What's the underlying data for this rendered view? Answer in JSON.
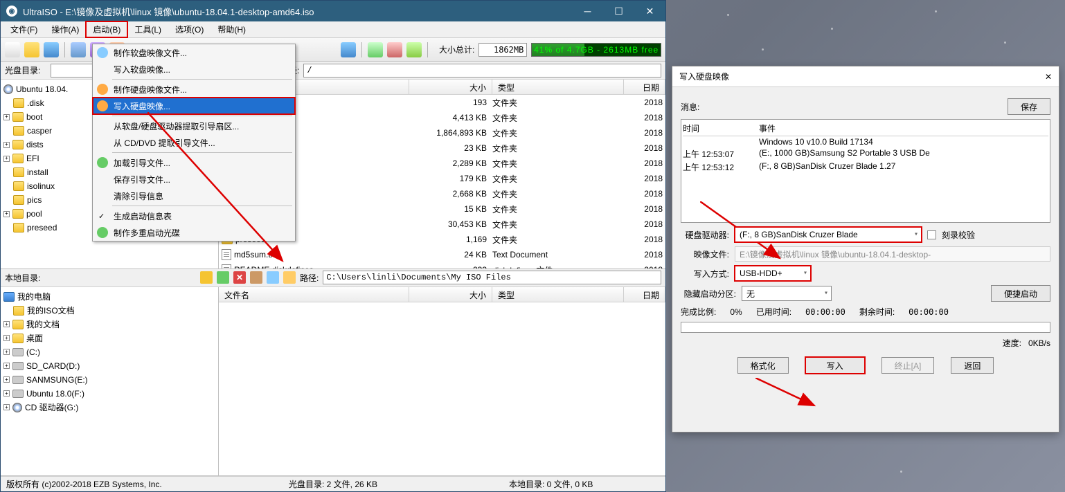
{
  "window": {
    "title": "UltraISO - E:\\镜像及虚拟机\\linux 镜像\\ubuntu-18.04.1-desktop-amd64.iso"
  },
  "menus": {
    "file": "文件(F)",
    "operate": "操作(A)",
    "boot": "启动(B)",
    "tools": "工具(L)",
    "options": "选项(O)",
    "help": "帮助(H)"
  },
  "toolbar": {
    "size_label": "大小总计:",
    "size_value": "1862MB",
    "usage_text": "41% of 4.7GB - 2613MB free"
  },
  "disc_panel": {
    "label": "光盘目录:",
    "path_label": "路径:",
    "path_value": "/"
  },
  "dropdown": {
    "make_floppy": "制作软盘映像文件...",
    "write_floppy": "写入软盘映像...",
    "make_hdd": "制作硬盘映像文件...",
    "write_hdd": "写入硬盘映像...",
    "from_floppy_hdd": "从软盘/硬盘驱动器提取引导扇区...",
    "from_cddvd": "从 CD/DVD 提取引导文件...",
    "load_boot": "加载引导文件...",
    "save_boot": "保存引导文件...",
    "clear_boot": "清除引导信息",
    "gen_boot_table": "生成启动信息表",
    "make_multi": "制作多重启动光碟"
  },
  "tree_top": {
    "root": "Ubuntu 18.04.",
    "items": [
      ".disk",
      "boot",
      "casper",
      "dists",
      "EFI",
      "install",
      "isolinux",
      "pics",
      "pool",
      "preseed"
    ]
  },
  "file_cols": {
    "name": "文件名",
    "size": "大小",
    "type": "类型",
    "date": "日期"
  },
  "files_top": [
    {
      "name": "",
      "size": "193",
      "type": "文件夹",
      "date": "2018"
    },
    {
      "name": "",
      "size": "4,413 KB",
      "type": "文件夹",
      "date": "2018"
    },
    {
      "name": "",
      "size": "1,864,893 KB",
      "type": "文件夹",
      "date": "2018"
    },
    {
      "name": "",
      "size": "23 KB",
      "type": "文件夹",
      "date": "2018"
    },
    {
      "name": "",
      "size": "2,289 KB",
      "type": "文件夹",
      "date": "2018"
    },
    {
      "name": "",
      "size": "179 KB",
      "type": "文件夹",
      "date": "2018"
    },
    {
      "name": "",
      "size": "2,668 KB",
      "type": "文件夹",
      "date": "2018"
    },
    {
      "name": "",
      "size": "15 KB",
      "type": "文件夹",
      "date": "2018"
    },
    {
      "name": "",
      "size": "30,453 KB",
      "type": "文件夹",
      "date": "2018"
    },
    {
      "name": "preseed",
      "size": "1,169",
      "type": "文件夹",
      "date": "2018",
      "ico": "folder"
    },
    {
      "name": "md5sum.txt",
      "size": "24 KB",
      "type": "Text Document",
      "date": "2018",
      "ico": "txt"
    },
    {
      "name": "README.diskdefines",
      "size": "233",
      "type": "diskdefines 文件",
      "date": "2018",
      "ico": "txt"
    }
  ],
  "local_panel": {
    "label": "本地目录:",
    "path_label": "路径:",
    "path_value": "C:\\Users\\linli\\Documents\\My ISO Files"
  },
  "tree_bottom": {
    "root": "我的电脑",
    "items": [
      "我的ISO文档",
      "我的文档",
      "桌面",
      "(C:)",
      "SD_CARD(D:)",
      "SANMSUNG(E:)",
      "Ubuntu 18.0(F:)",
      "CD 驱动器(G:)"
    ]
  },
  "status": {
    "copyright": "版权所有 (c)2002-2018 EZB Systems, Inc.",
    "disc": "光盘目录: 2 文件, 26 KB",
    "local": "本地目录: 0 文件, 0 KB"
  },
  "dialog": {
    "title": "写入硬盘映像",
    "msg_label": "消息:",
    "save_btn": "保存",
    "log_time_h": "时间",
    "log_event_h": "事件",
    "log": [
      {
        "time": "",
        "event": "Windows 10 v10.0 Build 17134"
      },
      {
        "time": "上午 12:53:07",
        "event": "(E:, 1000 GB)Samsung S2 Portable 3 USB De"
      },
      {
        "time": "上午 12:53:12",
        "event": "(F:, 8 GB)SanDisk Cruzer Blade   1.27"
      }
    ],
    "drive_label": "硬盘驱动器:",
    "drive_value": "(F:, 8 GB)SanDisk Cruzer Blade",
    "verify_label": "刻录校验",
    "image_label": "映像文件:",
    "image_value": "E:\\镜像及虚拟机\\linux 镜像\\ubuntu-18.04.1-desktop-",
    "method_label": "写入方式:",
    "method_value": "USB-HDD+",
    "hide_label": "隐藏启动分区:",
    "hide_value": "无",
    "quick_boot": "便捷启动",
    "done_label": "完成比例:",
    "done_value": "0%",
    "elapsed_label": "已用时间:",
    "elapsed_value": "00:00:00",
    "remain_label": "剩余时间:",
    "remain_value": "00:00:00",
    "speed_label": "速度:",
    "speed_value": "0KB/s",
    "btn_format": "格式化",
    "btn_write": "写入",
    "btn_abort": "终止[A]",
    "btn_back": "返回"
  }
}
